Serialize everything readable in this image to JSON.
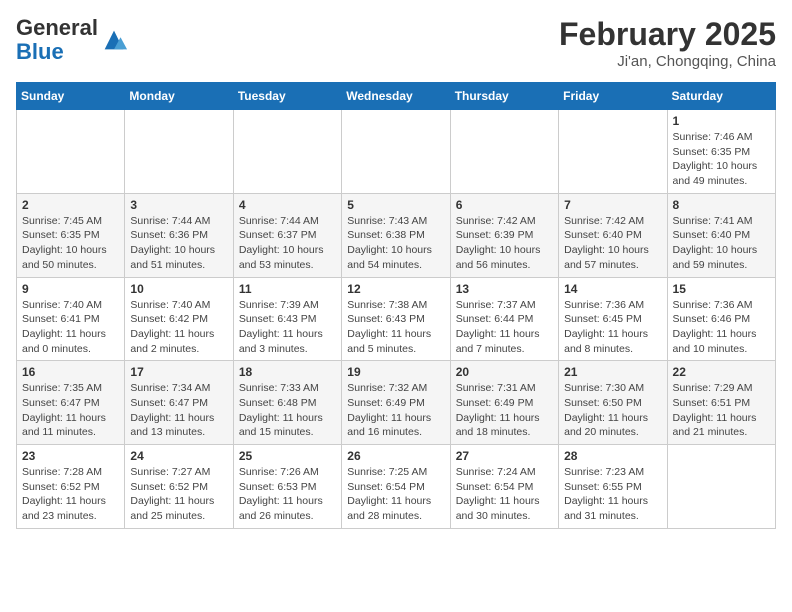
{
  "header": {
    "logo_general": "General",
    "logo_blue": "Blue",
    "month_title": "February 2025",
    "location": "Ji'an, Chongqing, China"
  },
  "days_of_week": [
    "Sunday",
    "Monday",
    "Tuesday",
    "Wednesday",
    "Thursday",
    "Friday",
    "Saturday"
  ],
  "weeks": [
    [
      {
        "day": "",
        "info": ""
      },
      {
        "day": "",
        "info": ""
      },
      {
        "day": "",
        "info": ""
      },
      {
        "day": "",
        "info": ""
      },
      {
        "day": "",
        "info": ""
      },
      {
        "day": "",
        "info": ""
      },
      {
        "day": "1",
        "info": "Sunrise: 7:46 AM\nSunset: 6:35 PM\nDaylight: 10 hours and 49 minutes."
      }
    ],
    [
      {
        "day": "2",
        "info": "Sunrise: 7:45 AM\nSunset: 6:35 PM\nDaylight: 10 hours and 50 minutes."
      },
      {
        "day": "3",
        "info": "Sunrise: 7:44 AM\nSunset: 6:36 PM\nDaylight: 10 hours and 51 minutes."
      },
      {
        "day": "4",
        "info": "Sunrise: 7:44 AM\nSunset: 6:37 PM\nDaylight: 10 hours and 53 minutes."
      },
      {
        "day": "5",
        "info": "Sunrise: 7:43 AM\nSunset: 6:38 PM\nDaylight: 10 hours and 54 minutes."
      },
      {
        "day": "6",
        "info": "Sunrise: 7:42 AM\nSunset: 6:39 PM\nDaylight: 10 hours and 56 minutes."
      },
      {
        "day": "7",
        "info": "Sunrise: 7:42 AM\nSunset: 6:40 PM\nDaylight: 10 hours and 57 minutes."
      },
      {
        "day": "8",
        "info": "Sunrise: 7:41 AM\nSunset: 6:40 PM\nDaylight: 10 hours and 59 minutes."
      }
    ],
    [
      {
        "day": "9",
        "info": "Sunrise: 7:40 AM\nSunset: 6:41 PM\nDaylight: 11 hours and 0 minutes."
      },
      {
        "day": "10",
        "info": "Sunrise: 7:40 AM\nSunset: 6:42 PM\nDaylight: 11 hours and 2 minutes."
      },
      {
        "day": "11",
        "info": "Sunrise: 7:39 AM\nSunset: 6:43 PM\nDaylight: 11 hours and 3 minutes."
      },
      {
        "day": "12",
        "info": "Sunrise: 7:38 AM\nSunset: 6:43 PM\nDaylight: 11 hours and 5 minutes."
      },
      {
        "day": "13",
        "info": "Sunrise: 7:37 AM\nSunset: 6:44 PM\nDaylight: 11 hours and 7 minutes."
      },
      {
        "day": "14",
        "info": "Sunrise: 7:36 AM\nSunset: 6:45 PM\nDaylight: 11 hours and 8 minutes."
      },
      {
        "day": "15",
        "info": "Sunrise: 7:36 AM\nSunset: 6:46 PM\nDaylight: 11 hours and 10 minutes."
      }
    ],
    [
      {
        "day": "16",
        "info": "Sunrise: 7:35 AM\nSunset: 6:47 PM\nDaylight: 11 hours and 11 minutes."
      },
      {
        "day": "17",
        "info": "Sunrise: 7:34 AM\nSunset: 6:47 PM\nDaylight: 11 hours and 13 minutes."
      },
      {
        "day": "18",
        "info": "Sunrise: 7:33 AM\nSunset: 6:48 PM\nDaylight: 11 hours and 15 minutes."
      },
      {
        "day": "19",
        "info": "Sunrise: 7:32 AM\nSunset: 6:49 PM\nDaylight: 11 hours and 16 minutes."
      },
      {
        "day": "20",
        "info": "Sunrise: 7:31 AM\nSunset: 6:49 PM\nDaylight: 11 hours and 18 minutes."
      },
      {
        "day": "21",
        "info": "Sunrise: 7:30 AM\nSunset: 6:50 PM\nDaylight: 11 hours and 20 minutes."
      },
      {
        "day": "22",
        "info": "Sunrise: 7:29 AM\nSunset: 6:51 PM\nDaylight: 11 hours and 21 minutes."
      }
    ],
    [
      {
        "day": "23",
        "info": "Sunrise: 7:28 AM\nSunset: 6:52 PM\nDaylight: 11 hours and 23 minutes."
      },
      {
        "day": "24",
        "info": "Sunrise: 7:27 AM\nSunset: 6:52 PM\nDaylight: 11 hours and 25 minutes."
      },
      {
        "day": "25",
        "info": "Sunrise: 7:26 AM\nSunset: 6:53 PM\nDaylight: 11 hours and 26 minutes."
      },
      {
        "day": "26",
        "info": "Sunrise: 7:25 AM\nSunset: 6:54 PM\nDaylight: 11 hours and 28 minutes."
      },
      {
        "day": "27",
        "info": "Sunrise: 7:24 AM\nSunset: 6:54 PM\nDaylight: 11 hours and 30 minutes."
      },
      {
        "day": "28",
        "info": "Sunrise: 7:23 AM\nSunset: 6:55 PM\nDaylight: 11 hours and 31 minutes."
      },
      {
        "day": "",
        "info": ""
      }
    ]
  ]
}
